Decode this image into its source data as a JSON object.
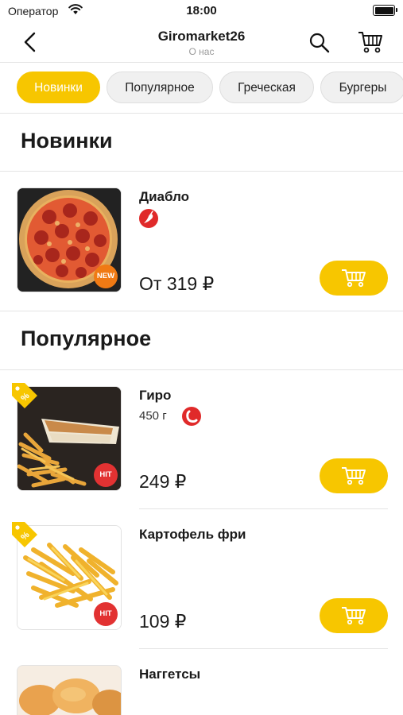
{
  "status_bar": {
    "carrier": "Оператор",
    "time": "18:00"
  },
  "header": {
    "title": "Giromarket26",
    "subtitle": "О нас"
  },
  "categories": [
    {
      "label": "Новинки",
      "active": true
    },
    {
      "label": "Популярное",
      "active": false
    },
    {
      "label": "Греческая",
      "active": false
    },
    {
      "label": "Бургеры",
      "active": false
    }
  ],
  "sections": [
    {
      "title": "Новинки",
      "products": [
        {
          "name": "Диабло",
          "weight": "",
          "price": "От 319 ₽",
          "badge": "NEW",
          "icon": "chili-icon",
          "image": "pizza"
        }
      ]
    },
    {
      "title": "Популярное",
      "products": [
        {
          "name": "Гиро",
          "weight": "450 г",
          "price": "249 ₽",
          "badge": "HIT",
          "icon": "sausage-icon",
          "image": "gyro",
          "discount_tag": true
        },
        {
          "name": "Картофель фри",
          "weight": "",
          "price": "109 ₽",
          "badge": "HIT",
          "icon": "",
          "image": "fries",
          "discount_tag": true
        },
        {
          "name": "Наггетсы",
          "weight": "",
          "price": "",
          "badge": "",
          "icon": "",
          "image": "nuggets"
        }
      ]
    }
  ],
  "colors": {
    "accent": "#f7c600",
    "badge_new": "#f07a14",
    "badge_hit": "#e23232",
    "spice": "#e02a2a"
  }
}
